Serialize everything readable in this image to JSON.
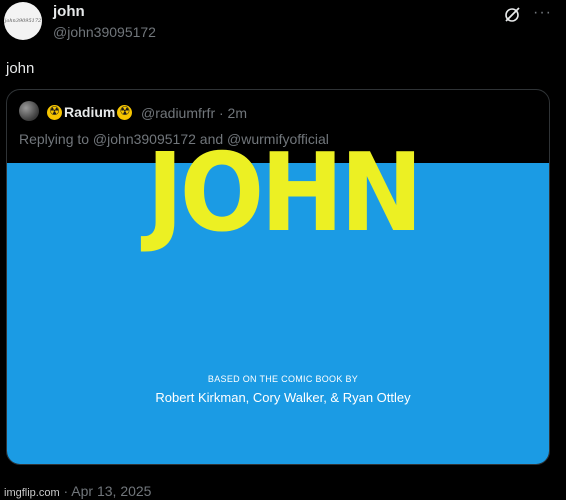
{
  "post": {
    "avatar_text": "john39095172",
    "display_name": "john",
    "handle": "@john39095172",
    "text": "john",
    "grok_icon": "grok-slash-icon",
    "more_icon": "more-dots-icon",
    "more_label": "···"
  },
  "quote": {
    "display_name": "Radium",
    "handle_time": "@radiumfrfr · 2m",
    "reply_context": "Replying to @john39095172 and @wurmifyofficial",
    "media": {
      "background_color": "#1b9be4",
      "title": "JOHN",
      "title_color": "#ecf023",
      "based_on": "BASED ON THE COMIC BOOK BY",
      "authors": "Robert Kirkman, Cory Walker, & Ryan Ottley"
    }
  },
  "footer": {
    "watermark": "imgflip.com",
    "date": "Apr 13, 2025"
  }
}
